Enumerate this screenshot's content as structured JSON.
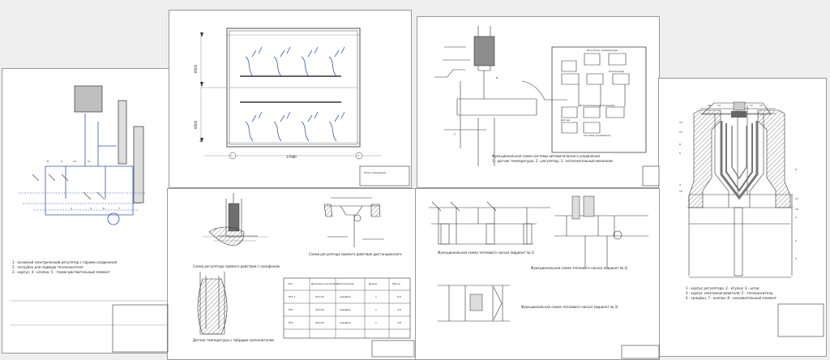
{
  "sheets": [
    {
      "id": "sheet-1",
      "captions": [
        "1 - основной электрический регулятор с парами соединения",
        "2 - патрубок для подвода теплоносителя",
        "3 - корпус; 4 - клапан; 5 - термочувствительный элемент"
      ],
      "labels": [
        "4",
        "5",
        "6",
        "7",
        "8",
        "9",
        "10",
        "11"
      ]
    },
    {
      "id": "sheet-2",
      "dimensions": [
        "17680",
        "6600",
        "6600"
      ],
      "labels": [
        "1",
        "2",
        "3"
      ],
      "caption": "План помещения"
    },
    {
      "id": "sheet-3",
      "labels": [
        "N",
        "a"
      ],
      "notes": [
        "Функциональная схема системы автоматического управления",
        "1 - датчик температуры; 2 - регулятор; 3 - исполнительный механизм"
      ],
      "blocks": [
        "Регулятор температуры",
        "Контроллер",
        "Исполнительный механизм",
        "Датчик",
        "Система управления"
      ]
    },
    {
      "id": "sheet-4",
      "callouts": [
        "18",
        "14",
        "17",
        "15",
        "12",
        "13",
        "6",
        "5",
        "4",
        "16",
        "11",
        "10",
        "9",
        "8",
        "2",
        "3"
      ],
      "legend": [
        "1 - корпус регулятора; 2 - втулка; 3 - шток;",
        "4 - корпус электронагревателя; 5 - теплоноситель;",
        "6 - сильфон; 7 - колпак; 8 - нагревательный элемент"
      ]
    },
    {
      "id": "sheet-5",
      "left_caption": "Схема регулятора прямого действия с сильфоном",
      "right_caption": "Схема регулятора прямого действия дистанционного",
      "bottom_caption": "Датчик температуры с твёрдым наполнителем",
      "table_headers": [
        "Тип",
        "Диапазон настройки",
        "Наполнитель",
        "Длина",
        "Масса"
      ],
      "table_rows": [
        [
          "РТ1-1",
          "20-120",
          "парафин",
          "1",
          "6,6"
        ],
        [
          "РТ2",
          "20-120",
          "парафин",
          "1",
          "4,0"
        ],
        [
          "РТ3",
          "40-140",
          "парафин",
          "1",
          "3,8"
        ]
      ]
    },
    {
      "id": "sheet-6",
      "captions": [
        "Функциональная схема теплового насоса (вариант № 1)",
        "Функциональная схема теплового насоса (вариант № 2)",
        "Функциональная схема теплового насоса (вариант № 3)"
      ]
    }
  ]
}
